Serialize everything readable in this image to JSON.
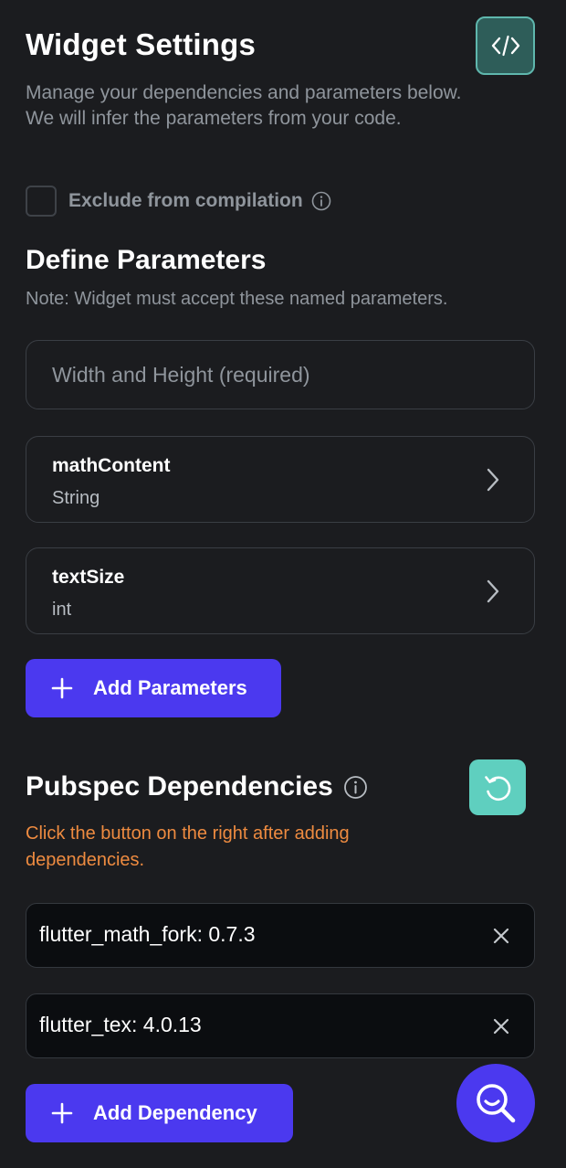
{
  "header": {
    "title": "Widget Settings",
    "description_line1": "Manage your dependencies and parameters below.",
    "description_line2": "We will infer the parameters from your code."
  },
  "exclude": {
    "label": "Exclude from compilation",
    "checked": false
  },
  "parameters": {
    "title": "Define Parameters",
    "note": "Note: Widget must accept these named parameters.",
    "width_height_label": "Width and Height (required)",
    "items": [
      {
        "name": "mathContent",
        "type": "String"
      },
      {
        "name": "textSize",
        "type": "int"
      }
    ],
    "add_label": "Add Parameters"
  },
  "dependencies": {
    "title": "Pubspec Dependencies",
    "warning": "Click the button on the right after adding dependencies.",
    "items": [
      {
        "value": "flutter_math_fork: 0.7.3"
      },
      {
        "value": "flutter_tex: 4.0.13"
      }
    ],
    "add_label": "Add Dependency"
  },
  "icons": {
    "code": "code-brackets-icon",
    "info": "info-circle-icon",
    "chevron": "chevron-right-icon",
    "plus": "plus-icon",
    "refresh": "refresh-icon",
    "close": "close-icon",
    "search": "search-smile-icon"
  },
  "colors": {
    "background": "#1b1c1f",
    "primary": "#4b39ef",
    "accent_teal": "#5fcfbf",
    "warning": "#ee8b40",
    "muted_text": "#8f959c"
  }
}
